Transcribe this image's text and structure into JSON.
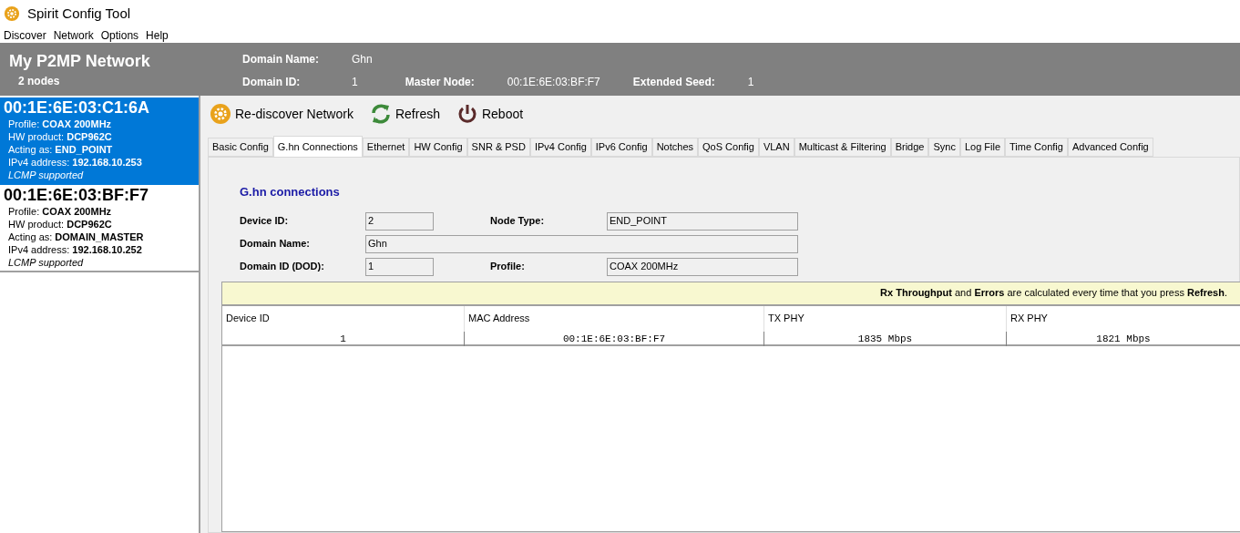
{
  "window": {
    "title": "Spirit Config Tool"
  },
  "menu": [
    "Discover",
    "Network",
    "Options",
    "Help"
  ],
  "header": {
    "network_name": "My P2MP Network",
    "node_count": "2 nodes",
    "fields": [
      {
        "label": "Domain Name:",
        "value": "Ghn"
      },
      {
        "label": "Domain ID:",
        "value": "1"
      },
      {
        "label": "Master Node:",
        "value": "00:1E:6E:03:BF:F7"
      },
      {
        "label": "Extended Seed:",
        "value": "1"
      }
    ]
  },
  "nodes": [
    {
      "mac": "00:1E:6E:03:C1:6A",
      "selected": true,
      "lines": [
        {
          "label": "Profile: ",
          "value": "COAX 200MHz"
        },
        {
          "label": "HW product: ",
          "value": "DCP962C"
        },
        {
          "label": "Acting as: ",
          "value": "END_POINT"
        },
        {
          "label": "IPv4 address: ",
          "value": "192.168.10.253"
        }
      ],
      "note": "LCMP supported"
    },
    {
      "mac": "00:1E:6E:03:BF:F7",
      "selected": false,
      "lines": [
        {
          "label": "Profile: ",
          "value": "COAX 200MHz"
        },
        {
          "label": "HW product: ",
          "value": "DCP962C"
        },
        {
          "label": "Acting as: ",
          "value": "DOMAIN_MASTER"
        },
        {
          "label": "IPv4 address: ",
          "value": "192.168.10.252"
        }
      ],
      "note": "LCMP supported"
    }
  ],
  "toolbar": [
    {
      "kind": "rediscover",
      "label": "Re-discover Network"
    },
    {
      "kind": "refresh",
      "label": "Refresh"
    },
    {
      "kind": "reboot",
      "label": "Reboot"
    }
  ],
  "tabs": [
    {
      "label": "Basic Config",
      "selected": false
    },
    {
      "label": "G.hn Connections",
      "selected": true
    },
    {
      "label": "Ethernet",
      "selected": false
    },
    {
      "label": "HW Config",
      "selected": false
    },
    {
      "label": "SNR & PSD",
      "selected": false
    },
    {
      "label": "IPv4 Config",
      "selected": false
    },
    {
      "label": "IPv6 Config",
      "selected": false
    },
    {
      "label": "Notches",
      "selected": false
    },
    {
      "label": "QoS Config",
      "selected": false
    },
    {
      "label": "VLAN",
      "selected": false
    },
    {
      "label": "Multicast & Filtering",
      "selected": false
    },
    {
      "label": "Bridge",
      "selected": false
    },
    {
      "label": "Sync",
      "selected": false
    },
    {
      "label": "Log File",
      "selected": false
    },
    {
      "label": "Time Config",
      "selected": false
    },
    {
      "label": "Advanced Config",
      "selected": false
    }
  ],
  "section_title": "G.hn connections",
  "form": {
    "device_id": {
      "label": "Device ID:",
      "value": "2"
    },
    "node_type": {
      "label": "Node Type:",
      "value": "END_POINT"
    },
    "domain_name": {
      "label": "Domain Name:",
      "value": "Ghn"
    },
    "domain_id": {
      "label": "Domain ID (DOD):",
      "value": "1"
    },
    "profile": {
      "label": "Profile:",
      "value": "COAX 200MHz"
    }
  },
  "notice": "**Rx Throughput** and **Errors** are calculated every time that you press **Refresh**.",
  "table": {
    "columns": [
      "Device ID",
      "MAC Address",
      "TX PHY",
      "RX PHY"
    ],
    "rows": [
      [
        "1",
        "00:1E:6E:03:BF:F7",
        "1835 Mbps",
        "1821 Mbps"
      ]
    ]
  }
}
